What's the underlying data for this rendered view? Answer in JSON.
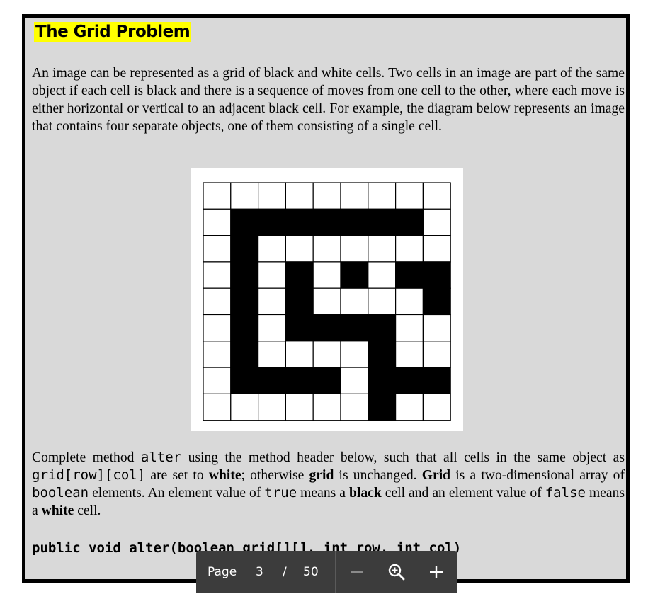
{
  "document": {
    "title": "The Grid Problem",
    "intro": "An image can be represented as a grid of black and white cells. Two cells in an image are part of the same object if each cell is black and there is a sequence of moves from one cell to the other, where each move is either horizontal or vertical to an adjacent black cell. For example, the diagram below represents an image that contains four separate objects, one of them consisting of a single cell.",
    "instructions": {
      "t1": "Complete method ",
      "c1": "alter",
      "t2": " using the method header below, such that all cells in the same object as ",
      "c2": "grid[row][col]",
      "t3": " are set to ",
      "b1": "white",
      "t4": "; otherwise ",
      "b2": "grid",
      "t5": " is unchanged. ",
      "b3": "Grid",
      "t6": " is a two-dimensional array of ",
      "c3": "boolean",
      "t7": " elements. An element value of ",
      "c4": "true",
      "t8": " means a ",
      "b4": "black",
      "t9": " cell and an element value of ",
      "c5": "false",
      "t10": " means a ",
      "b5": "white",
      "t11": " cell."
    },
    "method_header": "public void alter(boolean grid[][], int row, int col)"
  },
  "grid": [
    [
      0,
      0,
      0,
      0,
      0,
      0,
      0,
      0,
      0
    ],
    [
      0,
      1,
      1,
      1,
      1,
      1,
      1,
      1,
      0
    ],
    [
      0,
      1,
      0,
      0,
      0,
      0,
      0,
      0,
      0
    ],
    [
      0,
      1,
      0,
      1,
      0,
      1,
      0,
      1,
      1
    ],
    [
      0,
      1,
      0,
      1,
      0,
      0,
      0,
      0,
      1
    ],
    [
      0,
      1,
      0,
      1,
      1,
      1,
      1,
      0,
      0
    ],
    [
      0,
      1,
      0,
      0,
      0,
      0,
      1,
      0,
      0
    ],
    [
      0,
      1,
      1,
      1,
      1,
      0,
      1,
      1,
      1
    ],
    [
      0,
      0,
      0,
      0,
      0,
      0,
      1,
      0,
      0
    ]
  ],
  "toolbar": {
    "page_label": "Page",
    "page_number": "3",
    "separator": "/",
    "page_total": "50",
    "zoom_out_icon": "minus-icon",
    "zoom_icon": "zoom-icon",
    "zoom_in_icon": "plus-icon"
  },
  "colors": {
    "highlight": "#ffff00",
    "slide_bg": "#d9d9d9",
    "toolbar_bg": "#3c3c3c"
  }
}
